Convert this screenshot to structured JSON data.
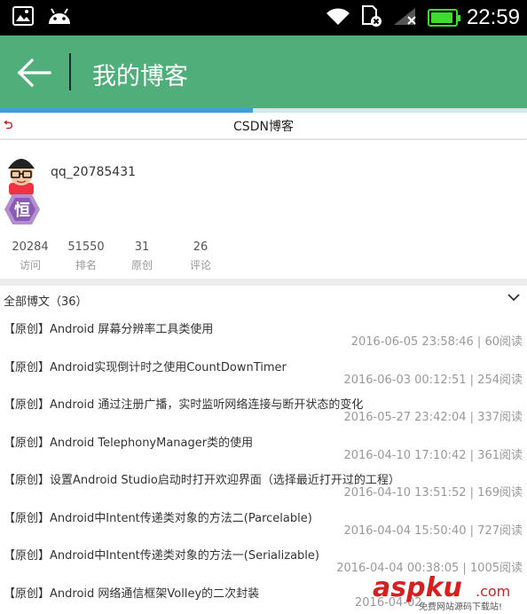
{
  "status_bar": {
    "time": "22:59",
    "icons": [
      "image-icon",
      "android-icon",
      "wifi-icon",
      "sim-icon",
      "signal-icon",
      "battery-icon"
    ]
  },
  "app_bar": {
    "title": "我的博客",
    "back_icon": "arrow-left-icon",
    "color": "#4fae79"
  },
  "progress": {
    "fraction": 0.48
  },
  "web_bar": {
    "back_icon": "reply-icon",
    "title": "CSDN博客"
  },
  "profile": {
    "username": "qq_20785431",
    "badge_text": "恒",
    "stats": [
      {
        "value": "20284",
        "label": "访问"
      },
      {
        "value": "51550",
        "label": "排名"
      },
      {
        "value": "31",
        "label": "原创"
      },
      {
        "value": "26",
        "label": "评论"
      }
    ]
  },
  "list_header": {
    "title": "全部博文（36）",
    "icon": "chevron-down-icon"
  },
  "posts": [
    {
      "tag": "【原创】",
      "title": "Android 屏幕分辨率工具类使用",
      "meta": "2016-06-05 23:58:46 | 60阅读"
    },
    {
      "tag": "【原创】",
      "title": "Android实现倒计时之使用CountDownTimer",
      "meta": "2016-06-03 00:12:51 | 254阅读"
    },
    {
      "tag": "【原创】",
      "title": "Android 通过注册广播，实时监听网络连接与断开状态的变化",
      "meta": "2016-05-27 23:42:04 | 337阅读"
    },
    {
      "tag": "【原创】",
      "title": "Android TelephonyManager类的使用",
      "meta": "2016-04-10 17:10:42 | 361阅读"
    },
    {
      "tag": "【原创】",
      "title": "设置Android Studio启动时打开欢迎界面（选择最近打开过的工程）",
      "meta": "2016-04-10 13:51:52 | 169阅读"
    },
    {
      "tag": "【原创】",
      "title": "Android中Intent传递类对象的方法二(Parcelable)",
      "meta": "2016-04-04 15:50:40 | 727阅读"
    },
    {
      "tag": "【原创】",
      "title": "Android中Intent传递类对象的方法一(Serializable)",
      "meta": "2016-04-04 00:38:05 | 1005阅读"
    },
    {
      "tag": "【原创】",
      "title": "Android 网络通信框架Volley的二次封装",
      "meta": "2016-04-02"
    }
  ],
  "watermark": {
    "brand": "aspku",
    "suffix": ".com",
    "caption": "免费网站源码下载站!"
  }
}
